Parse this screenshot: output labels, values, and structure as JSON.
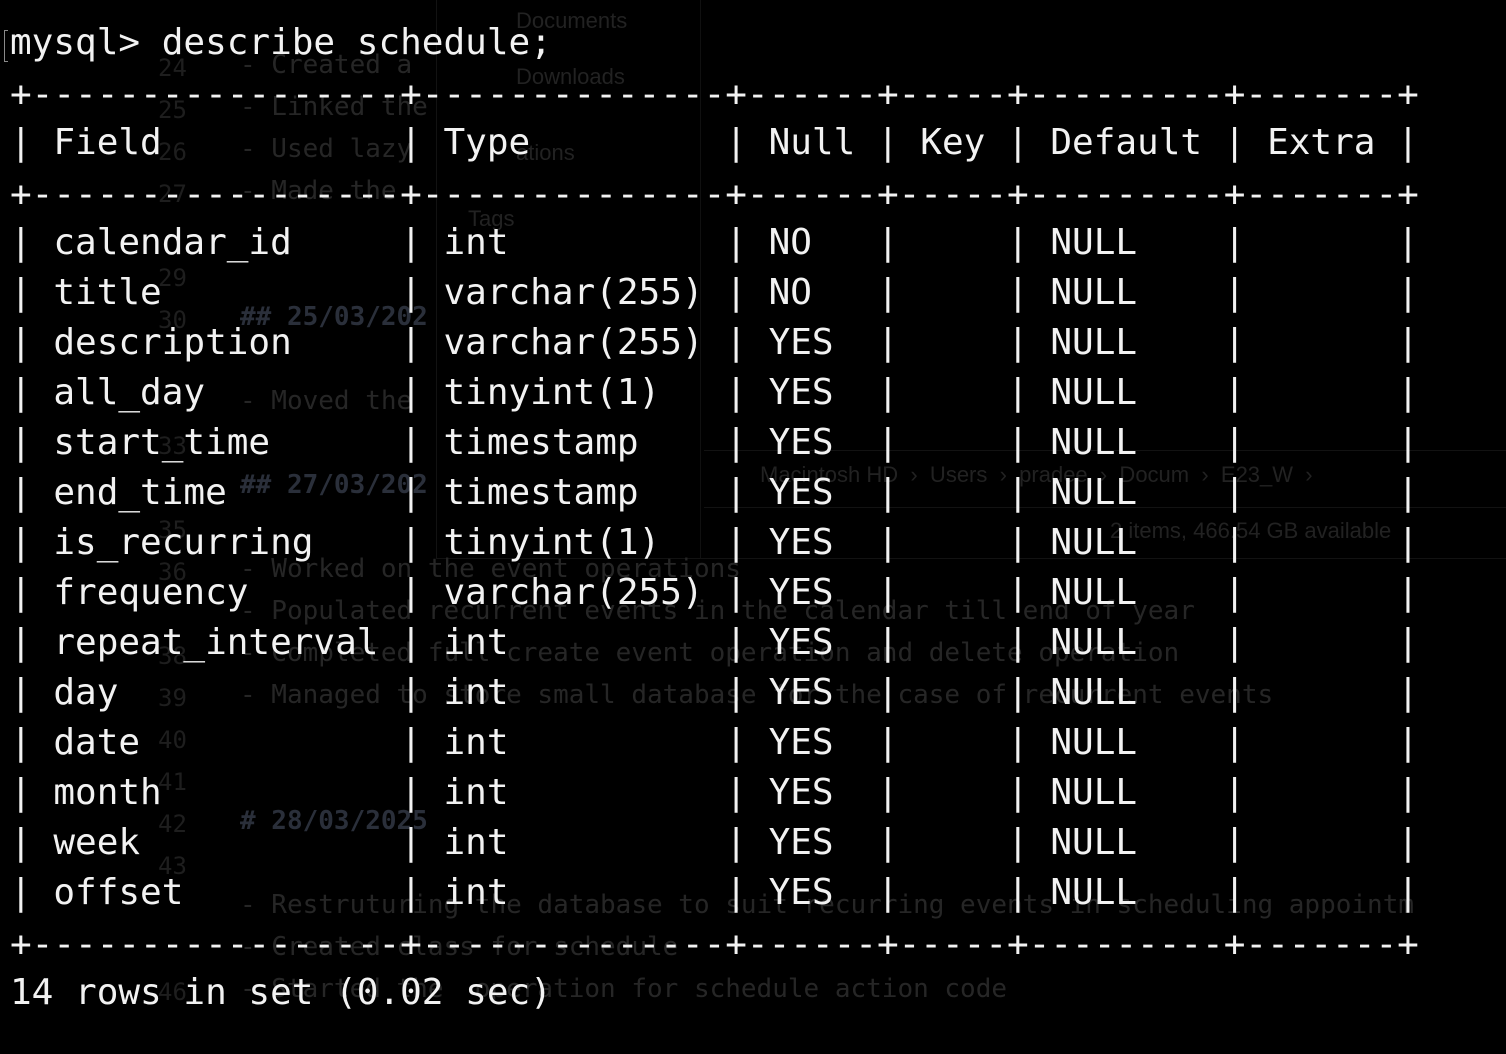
{
  "terminal": {
    "prompt": "mysql> ",
    "command": "describe schedule;",
    "border_line": "+-----------------+--------------+------+-----+---------+-------+",
    "header_row": "| Field           | Type         | Null | Key | Default | Extra |",
    "columns": [
      "Field",
      "Type",
      "Null",
      "Key",
      "Default",
      "Extra"
    ],
    "rows": [
      {
        "line": "| calendar_id     | int          | NO   |     | NULL    |       |",
        "field": "calendar_id",
        "type": "int",
        "null": "NO",
        "key": "",
        "default": "NULL",
        "extra": ""
      },
      {
        "line": "| title           | varchar(255) | NO   |     | NULL    |       |",
        "field": "title",
        "type": "varchar(255)",
        "null": "NO",
        "key": "",
        "default": "NULL",
        "extra": ""
      },
      {
        "line": "| description     | varchar(255) | YES  |     | NULL    |       |",
        "field": "description",
        "type": "varchar(255)",
        "null": "YES",
        "key": "",
        "default": "NULL",
        "extra": ""
      },
      {
        "line": "| all_day         | tinyint(1)   | YES  |     | NULL    |       |",
        "field": "all_day",
        "type": "tinyint(1)",
        "null": "YES",
        "key": "",
        "default": "NULL",
        "extra": ""
      },
      {
        "line": "| start_time      | timestamp    | YES  |     | NULL    |       |",
        "field": "start_time",
        "type": "timestamp",
        "null": "YES",
        "key": "",
        "default": "NULL",
        "extra": ""
      },
      {
        "line": "| end_time        | timestamp    | YES  |     | NULL    |       |",
        "field": "end_time",
        "type": "timestamp",
        "null": "YES",
        "key": "",
        "default": "NULL",
        "extra": ""
      },
      {
        "line": "| is_recurring    | tinyint(1)   | YES  |     | NULL    |       |",
        "field": "is_recurring",
        "type": "tinyint(1)",
        "null": "YES",
        "key": "",
        "default": "NULL",
        "extra": ""
      },
      {
        "line": "| frequency       | varchar(255) | YES  |     | NULL    |       |",
        "field": "frequency",
        "type": "varchar(255)",
        "null": "YES",
        "key": "",
        "default": "NULL",
        "extra": ""
      },
      {
        "line": "| repeat_interval | int          | YES  |     | NULL    |       |",
        "field": "repeat_interval",
        "type": "int",
        "null": "YES",
        "key": "",
        "default": "NULL",
        "extra": ""
      },
      {
        "line": "| day             | int          | YES  |     | NULL    |       |",
        "field": "day",
        "type": "int",
        "null": "YES",
        "key": "",
        "default": "NULL",
        "extra": ""
      },
      {
        "line": "| date            | int          | YES  |     | NULL    |       |",
        "field": "date",
        "type": "int",
        "null": "YES",
        "key": "",
        "default": "NULL",
        "extra": ""
      },
      {
        "line": "| month           | int          | YES  |     | NULL    |       |",
        "field": "month",
        "type": "int",
        "null": "YES",
        "key": "",
        "default": "NULL",
        "extra": ""
      },
      {
        "line": "| week            | int          | YES  |     | NULL    |       |",
        "field": "week",
        "type": "int",
        "null": "YES",
        "key": "",
        "default": "NULL",
        "extra": ""
      },
      {
        "line": "| offset          | int          | YES  |     | NULL    |       |",
        "field": "offset",
        "type": "int",
        "null": "YES",
        "key": "",
        "default": "NULL",
        "extra": ""
      }
    ],
    "footer": "14 rows in set (0.02 sec)"
  },
  "background": {
    "finder_sidebar": [
      "Documents",
      "Downloads",
      "ations",
      "Tags"
    ],
    "finder_path": "Macintosh HD  ›  Users  ›  pradee  ›  Docum  ›  E23_W  ›",
    "finder_status": "2 items, 466.54 GB available",
    "editor_line_numbers": [
      "24",
      "25",
      "26",
      "27",
      "29",
      "30",
      "33",
      "35",
      "36",
      "38",
      "39",
      "40",
      "41",
      "42",
      "43",
      "46"
    ],
    "editor_lines": [
      "- Created a",
      "- Linked the",
      "- Used lazy",
      "- Made the",
      "## 25/03/202",
      "- Moved the",
      "## 27/03/202",
      "- Worked on the event operations",
      "- Populated recurrent events in the calendar till end of year",
      "- Completed full create event operation and delete operation",
      "- Managed to store small database for the case of recurrent events",
      "# 28/03/2025",
      "- Restruturing the database to suit recurring events in scheduling appointm",
      "- Created class for schedule",
      "- Started the  operation for schedule action code"
    ]
  },
  "colors": {
    "background": "#000000",
    "terminal_text": "#f2f2f2",
    "ghost_text": "#262626"
  }
}
